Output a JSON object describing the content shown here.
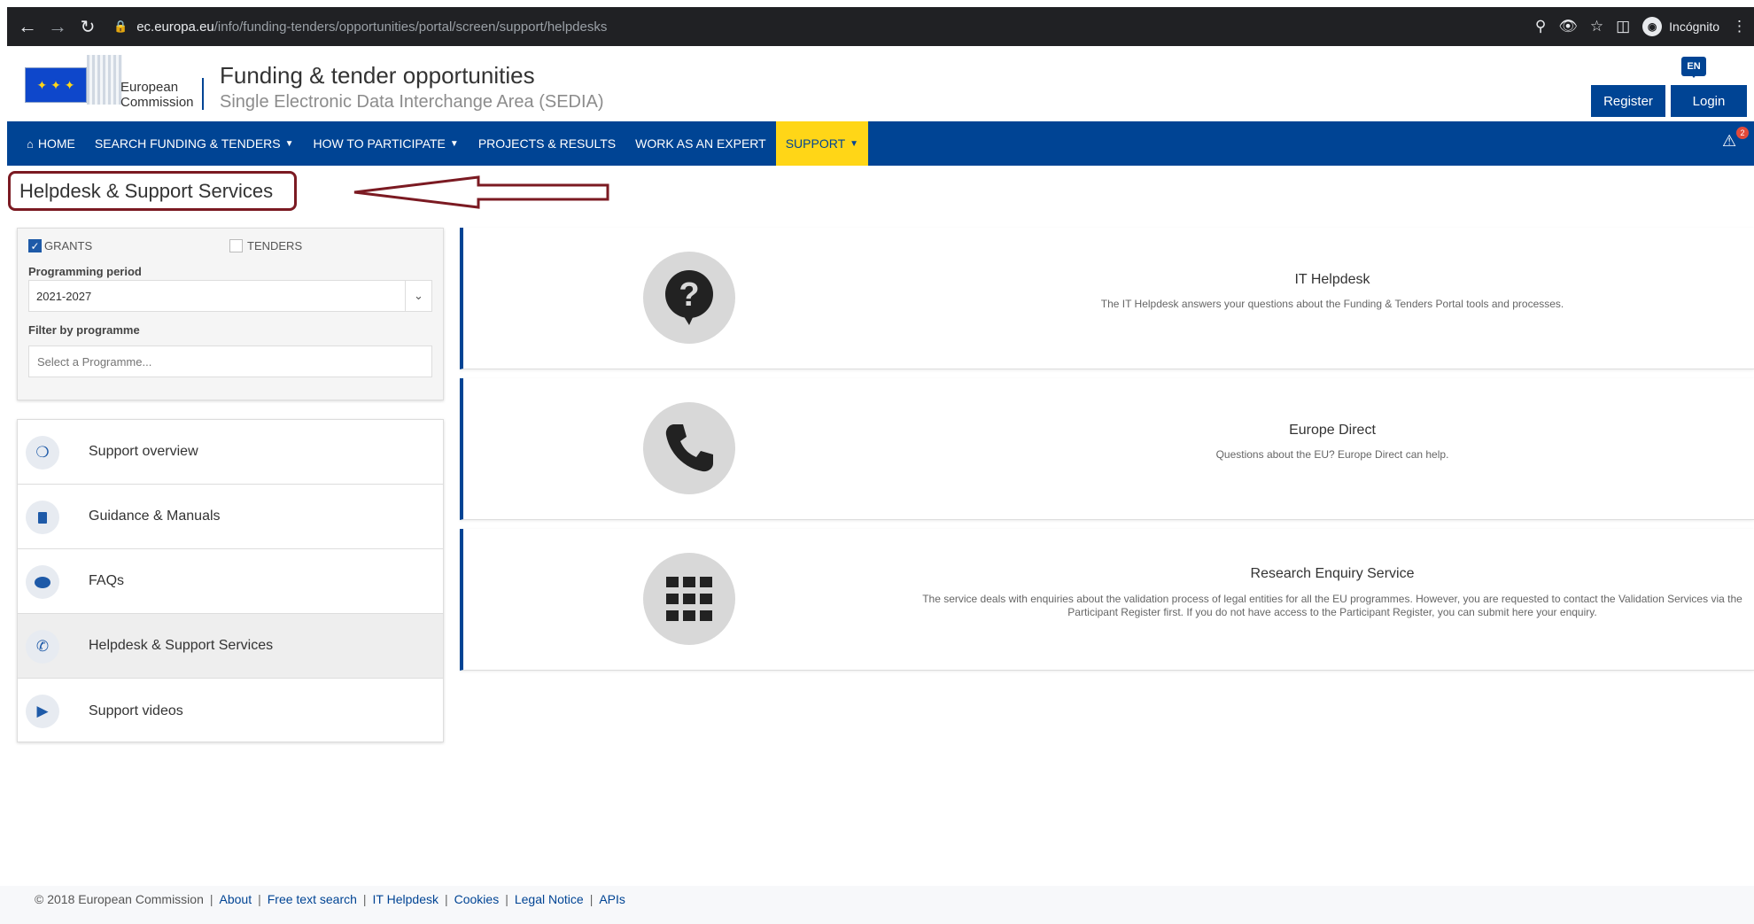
{
  "browser": {
    "url_host": "ec.europa.eu",
    "url_path": "/info/funding-tenders/opportunities/portal/screen/support/helpdesks",
    "profile_label": "Incógnito"
  },
  "header": {
    "org_line1": "European",
    "org_line2": "Commission",
    "site_title": "Funding & tender opportunities",
    "site_subtitle": "Single Electronic Data Interchange Area (SEDIA)",
    "lang": "EN",
    "register": "Register",
    "login": "Login"
  },
  "nav": {
    "items": [
      {
        "label": "HOME",
        "icon": "home-icon"
      },
      {
        "label": "SEARCH FUNDING & TENDERS",
        "dropdown": true
      },
      {
        "label": "HOW TO PARTICIPATE",
        "dropdown": true
      },
      {
        "label": "PROJECTS & RESULTS"
      },
      {
        "label": "WORK AS AN EXPERT"
      },
      {
        "label": "SUPPORT",
        "dropdown": true,
        "active": true
      }
    ],
    "alert_count": "2"
  },
  "page": {
    "title": "Helpdesk & Support Services"
  },
  "filters": {
    "grants_label": "GRANTS",
    "grants_checked": true,
    "tenders_label": "TENDERS",
    "tenders_checked": false,
    "period_label": "Programming period",
    "period_value": "2021-2027",
    "programme_label": "Filter by programme",
    "programme_placeholder": "Select a Programme..."
  },
  "sidemenu": {
    "items": [
      {
        "label": "Support overview",
        "icon": "lifebuoy-icon"
      },
      {
        "label": "Guidance & Manuals",
        "icon": "book-icon"
      },
      {
        "label": "FAQs",
        "icon": "chat-bubble-icon"
      },
      {
        "label": "Helpdesk & Support Services",
        "icon": "phone-icon",
        "active": true
      },
      {
        "label": "Support videos",
        "icon": "play-icon"
      }
    ]
  },
  "cards": [
    {
      "title": "IT Helpdesk",
      "description": "The IT Helpdesk answers your questions about the Funding & Tenders Portal tools and processes.",
      "icon": "question-bubble-icon"
    },
    {
      "title": "Europe Direct",
      "description": "Questions about the EU? Europe Direct can help.",
      "icon": "phone-icon"
    },
    {
      "title": "Research Enquiry Service",
      "description": "The service deals with enquiries about the validation process of legal entities for all the EU programmes. However, you are requested to contact the Validation Services via the Participant Register first. If you do not have access to the Participant Register, you can submit here your enquiry.",
      "icon": "grid-icon"
    }
  ],
  "footer": {
    "copyright": "© 2018 European Commission",
    "links": [
      "About",
      "Free text search",
      "IT Helpdesk",
      "Cookies",
      "Legal Notice",
      "APIs"
    ]
  },
  "colors": {
    "ec_blue": "#004494",
    "ec_yellow": "#ffd617",
    "annotation_red": "#7b1a22"
  }
}
